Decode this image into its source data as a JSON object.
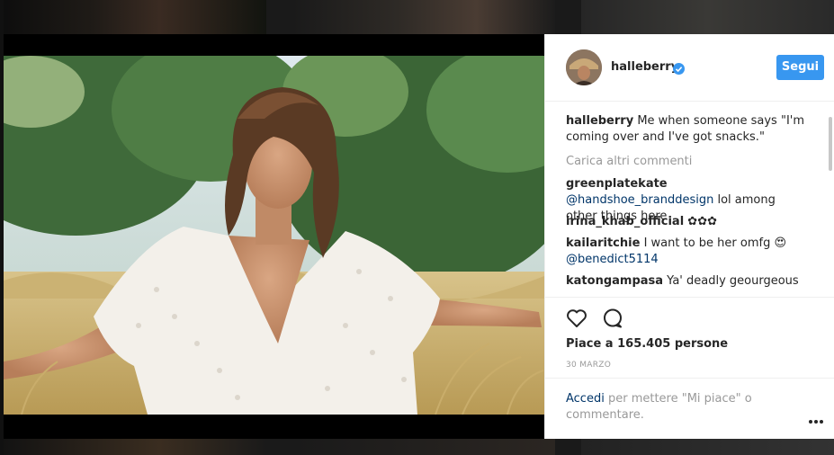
{
  "post": {
    "username": "halleberry",
    "follow_label": "Segui",
    "caption_user": "halleberry",
    "caption_text": "Me when someone says \"I'm coming over and I've got snacks.\"",
    "load_more_label": "Carica altri commenti",
    "likes_label": "Piace a 165.405 persone",
    "date_label": "30 MARZO"
  },
  "comments": [
    {
      "user": "greenplatekate",
      "mention": "@handshoe_branddesign",
      "text": "lol among other things here"
    },
    {
      "user": "irina_khab_official",
      "text": "✿✿✿"
    },
    {
      "user": "kailaritchie",
      "text": "I want to be her omfg 😍",
      "mention": "@benedict5114"
    },
    {
      "user": "katongampasa",
      "text": "Ya' deadly geourgeous"
    }
  ],
  "login": {
    "link_label": "Accedi",
    "rest_text": "per mettere \"Mi piace\" o commentare."
  },
  "icons": {
    "verified": "verified-badge-icon",
    "like": "heart-outline-icon",
    "comment": "speech-bubble-icon",
    "more": "more-options-icon"
  },
  "colors": {
    "accent": "#3897f0",
    "link": "#003569",
    "muted": "#999999",
    "text": "#262626"
  }
}
